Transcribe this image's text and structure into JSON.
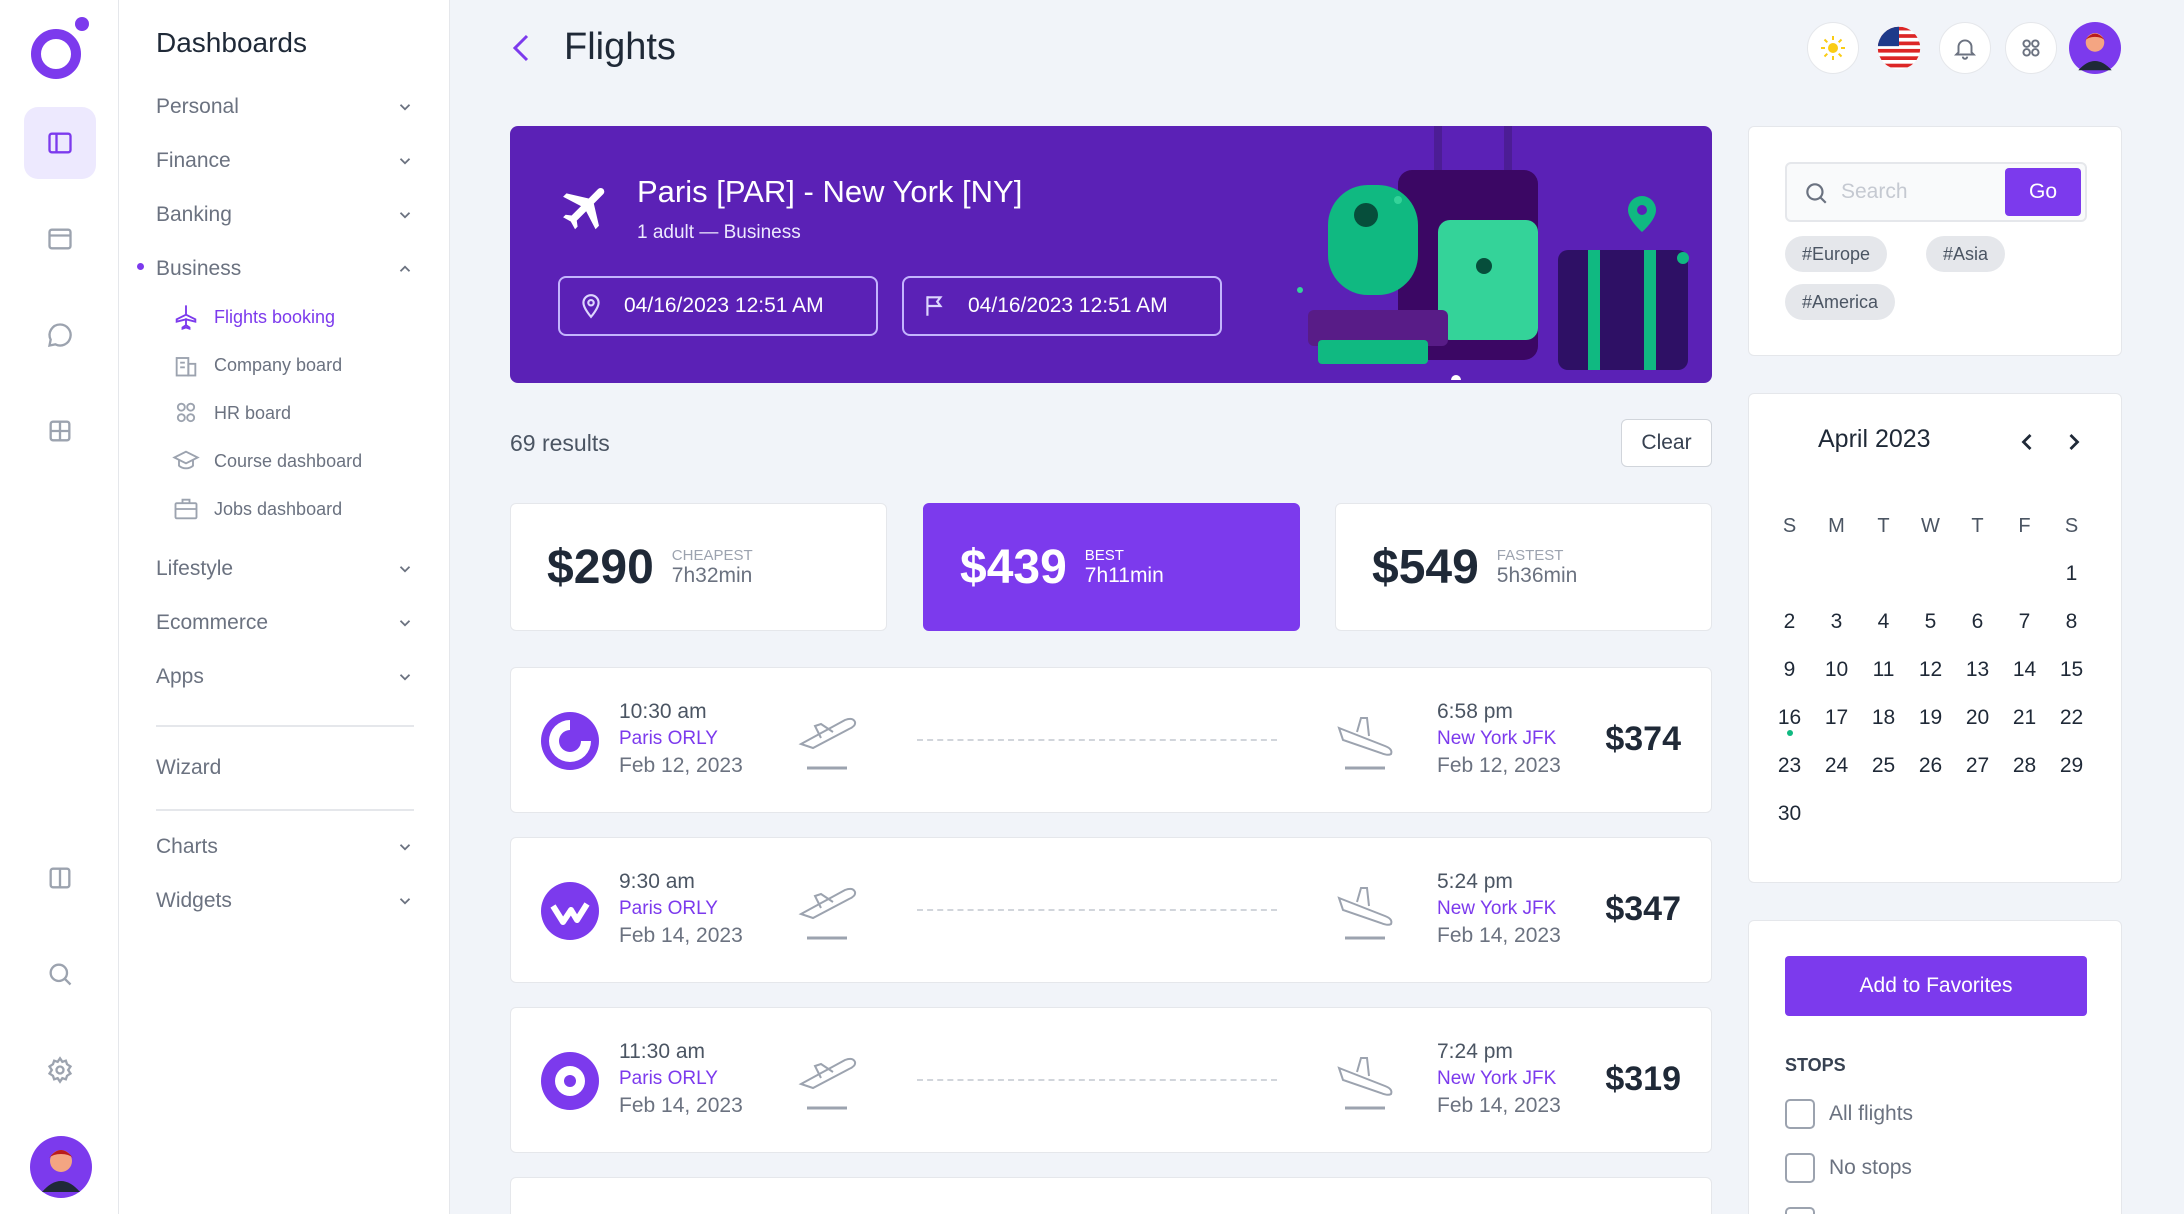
{
  "menu": {
    "title": "Dashboards",
    "items": [
      {
        "label": "Personal"
      },
      {
        "label": "Finance"
      },
      {
        "label": "Banking"
      },
      {
        "label": "Business"
      },
      {
        "label": "Lifestyle"
      },
      {
        "label": "Ecommerce"
      },
      {
        "label": "Apps"
      },
      {
        "label": "Wizard"
      },
      {
        "label": "Charts"
      },
      {
        "label": "Widgets"
      }
    ],
    "business_sub": [
      {
        "label": "Flights booking",
        "icon": "airplane-icon"
      },
      {
        "label": "Company board",
        "icon": "building-icon"
      },
      {
        "label": "HR board",
        "icon": "people-icon"
      },
      {
        "label": "Course dashboard",
        "icon": "graduation-cap-icon"
      },
      {
        "label": "Jobs dashboard",
        "icon": "briefcase-icon"
      }
    ]
  },
  "header": {
    "title": "Flights"
  },
  "hero": {
    "route": "Paris [PAR] - New York [NY]",
    "passengers": "1 adult — Business",
    "depart_date": "04/16/2023 12:51 AM",
    "return_date": "04/16/2023 12:51 AM"
  },
  "results": {
    "count_text": "69 results",
    "clear_label": "Clear"
  },
  "price_summary": [
    {
      "amount": "$290",
      "label": "CHEAPEST",
      "duration": "7h32min"
    },
    {
      "amount": "$439",
      "label": "BEST",
      "duration": "7h11min"
    },
    {
      "amount": "$549",
      "label": "FASTEST",
      "duration": "5h36min"
    }
  ],
  "flights": [
    {
      "dep_time": "10:30 am",
      "dep_airport": "Paris ORLY",
      "dep_date": "Feb 12, 2023",
      "arr_time": "6:58 pm",
      "arr_airport": "New York JFK",
      "arr_date": "Feb 12, 2023",
      "price": "$374"
    },
    {
      "dep_time": "9:30 am",
      "dep_airport": "Paris ORLY",
      "dep_date": "Feb 14, 2023",
      "arr_time": "5:24 pm",
      "arr_airport": "New York JFK",
      "arr_date": "Feb 14, 2023",
      "price": "$347"
    },
    {
      "dep_time": "11:30 am",
      "dep_airport": "Paris ORLY",
      "dep_date": "Feb 14, 2023",
      "arr_time": "7:24 pm",
      "arr_airport": "New York JFK",
      "arr_date": "Feb 14, 2023",
      "price": "$319"
    }
  ],
  "search": {
    "placeholder": "Search",
    "go_label": "Go",
    "tags": [
      "#Europe",
      "#Asia",
      "#America"
    ]
  },
  "calendar": {
    "title": "April 2023",
    "weekdays": [
      "S",
      "M",
      "T",
      "W",
      "T",
      "F",
      "S"
    ],
    "days": [
      "",
      "",
      "",
      "",
      "",
      "",
      "1",
      "2",
      "3",
      "4",
      "5",
      "6",
      "7",
      "8",
      "9",
      "10",
      "11",
      "12",
      "13",
      "14",
      "15",
      "16",
      "17",
      "18",
      "19",
      "20",
      "21",
      "22",
      "23",
      "24",
      "25",
      "26",
      "27",
      "28",
      "29",
      "30"
    ],
    "today": "16"
  },
  "filters": {
    "favorites_label": "Add to Favorites",
    "stops_title": "STOPS",
    "options": [
      "All flights",
      "No stops"
    ]
  },
  "colors": {
    "accent": "#7c3aed",
    "hero_bg": "#5b21b6",
    "background": "#f1f4f9",
    "today_dot": "#10b981"
  }
}
